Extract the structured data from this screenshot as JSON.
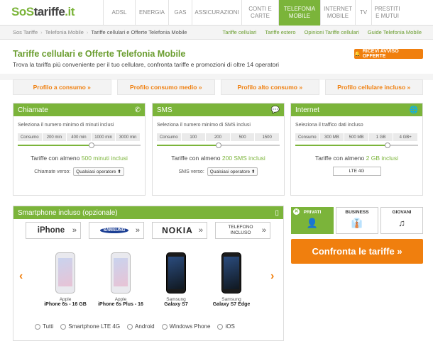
{
  "logo": {
    "so": "SoS",
    "brand": "tariffe",
    "tld": ".it"
  },
  "nav": [
    {
      "label": "ADSL"
    },
    {
      "label": "ENERGIA"
    },
    {
      "label": "GAS"
    },
    {
      "label": "ASSICURAZIONI"
    },
    {
      "label": "CONTI E CARTE"
    },
    {
      "label": "TELEFONIA MOBILE"
    },
    {
      "label": "INTERNET MOBILE"
    },
    {
      "label": "TV"
    },
    {
      "label": "PRESTITI E MUTUI"
    }
  ],
  "breadcrumb": [
    "Sos Tariffe",
    "Telefonia Mobile",
    "Tariffe cellulari e Offerte Telefonia Mobile"
  ],
  "sublinks": [
    "Tariffe cellulari",
    "Tariffe estero",
    "Opinioni Tariffe cellulari",
    "Guide Telefonia Mobile"
  ],
  "page": {
    "title": "Tariffe cellulari e Offerte Telefonia Mobile",
    "subtitle": "Trova la tariffa più conveniente per il tuo cellulare, confronta tariffe e promozioni di oltre 14 operatori",
    "alert_button": "RICEVI AVVISO OFFERTE"
  },
  "profiles": [
    "Profilo a consumo »",
    "Profilo consumo medio »",
    "Profilo alto consumo »",
    "Profilo cellulare incluso »"
  ],
  "panels": {
    "calls": {
      "title": "Chiamate",
      "desc": "Seleziona il numero minimo di minuti inclusi",
      "steps": [
        "Consumo",
        "200 min",
        "400 min",
        "1000 min",
        "3000 min"
      ],
      "level": 0.6,
      "summary_prefix": "Tariffe con almeno ",
      "summary_value": "500 minuti inclusi",
      "chooser_label": "Chiamate verso:",
      "chooser_value": "Qualsiasi operatore ⬍"
    },
    "sms": {
      "title": "SMS",
      "desc": "Seleziona il numero minimo di SMS inclusi",
      "steps": [
        "Consumo",
        "100",
        "200",
        "500",
        "1500"
      ],
      "level": 0.5,
      "summary_prefix": "Tariffe con almeno ",
      "summary_value": "200 SMS inclusi",
      "chooser_label": "SMS verso:",
      "chooser_value": "Qualsiasi operatore ⬍"
    },
    "internet": {
      "title": "Internet",
      "desc": "Seleziona il traffico dati incluso",
      "steps": [
        "Consumo",
        "300 MB",
        "500 MB",
        "1 GB",
        "4 GB+"
      ],
      "level": 0.75,
      "summary_prefix": "Tariffe con almeno ",
      "summary_value": "2 GB inclusi",
      "lte": "LTE 4G"
    }
  },
  "smartphone": {
    "title": "Smartphone incluso (opzionale)",
    "brands": [
      "iPhone",
      "SAMSUNG",
      "NOKIA",
      "TELEFONO INCLUSO"
    ],
    "arrow": "»",
    "phones": [
      {
        "brand": "Apple",
        "model": "iPhone 6s - 16 GB",
        "style": "iphone"
      },
      {
        "brand": "Apple",
        "model": "iPhone 6s Plus - 16",
        "style": "iphone"
      },
      {
        "brand": "Samsung",
        "model": "Galaxy S7",
        "style": "galaxy"
      },
      {
        "brand": "Samsung",
        "model": "Galaxy S7 Edge",
        "style": "galaxy"
      }
    ],
    "filters": [
      "Tutti",
      "Smartphone LTE 4G",
      "Android",
      "Windows Phone",
      "iOS"
    ]
  },
  "user_types": [
    {
      "label": "PRIVATI",
      "icon": "person-icon",
      "active": true
    },
    {
      "label": "BUSINESS",
      "icon": "tie-icon",
      "active": false
    },
    {
      "label": "GIOVANI",
      "icon": "music-icon",
      "active": false
    }
  ],
  "cta": "Confronta le tariffe »",
  "colors": {
    "green": "#7bb43a",
    "orange": "#f07f0e"
  }
}
